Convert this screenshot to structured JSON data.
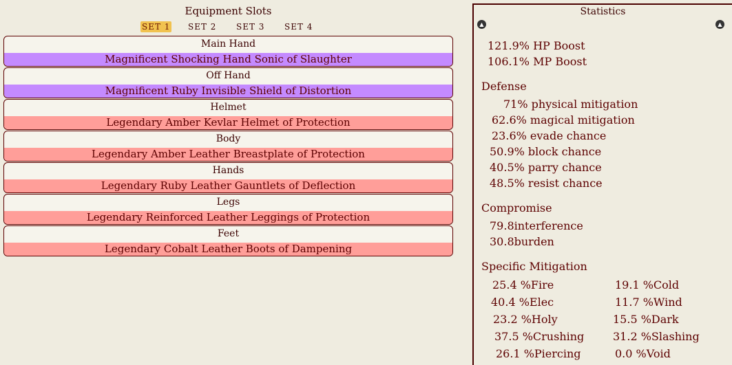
{
  "colors": {
    "purple": "#c48aff",
    "red": "#ff9e99"
  },
  "equipment": {
    "title": "Equipment Slots",
    "sets": [
      "SET 1",
      "SET 2",
      "SET 3",
      "SET 4"
    ],
    "active_set": "SET 1",
    "slots": [
      {
        "label": "Main Hand",
        "item": "Magnificent Shocking Hand Sonic of Slaughter",
        "color": "#c48aff"
      },
      {
        "label": "Off Hand",
        "item": "Magnificent Ruby Invisible Shield of Distortion",
        "color": "#c48aff"
      },
      {
        "label": "Helmet",
        "item": "Legendary Amber Kevlar Helmet of Protection",
        "color": "#ff9e99"
      },
      {
        "label": "Body",
        "item": "Legendary Amber Leather Breastplate of Protection",
        "color": "#ff9e99"
      },
      {
        "label": "Hands",
        "item": "Legendary Ruby Leather Gauntlets of Deflection",
        "color": "#ff9e99"
      },
      {
        "label": "Legs",
        "item": "Legendary Reinforced Leather Leggings of Protection",
        "color": "#ff9e99"
      },
      {
        "label": "Feet",
        "item": "Legendary Cobalt Leather Boots of Dampening",
        "color": "#ff9e99"
      }
    ]
  },
  "statistics": {
    "title": "Statistics",
    "scroll_up_icon": "circle-up-arrow-icon",
    "boosts": [
      "121.9% HP Boost",
      "106.1% MP Boost"
    ],
    "defense_header": "Defense",
    "defense": [
      "71% physical mitigation",
      "62.6% magical mitigation",
      "23.6% evade chance",
      "50.9% block chance",
      "40.5% parry chance",
      "48.5% resist chance"
    ],
    "compromise_header": "Compromise",
    "compromise": [
      "79.8interference",
      "30.8burden"
    ],
    "specific_header": "Specific Mitigation",
    "specific_left": [
      "25.4 %Fire",
      "40.4 %Elec",
      "23.2 %Holy",
      "37.5 %Crushing",
      "26.1 %Piercing"
    ],
    "specific_right": [
      "19.1 %Cold",
      "11.7 %Wind",
      "15.5 %Dark",
      "31.2 %Slashing",
      "0.0 %Void"
    ]
  }
}
